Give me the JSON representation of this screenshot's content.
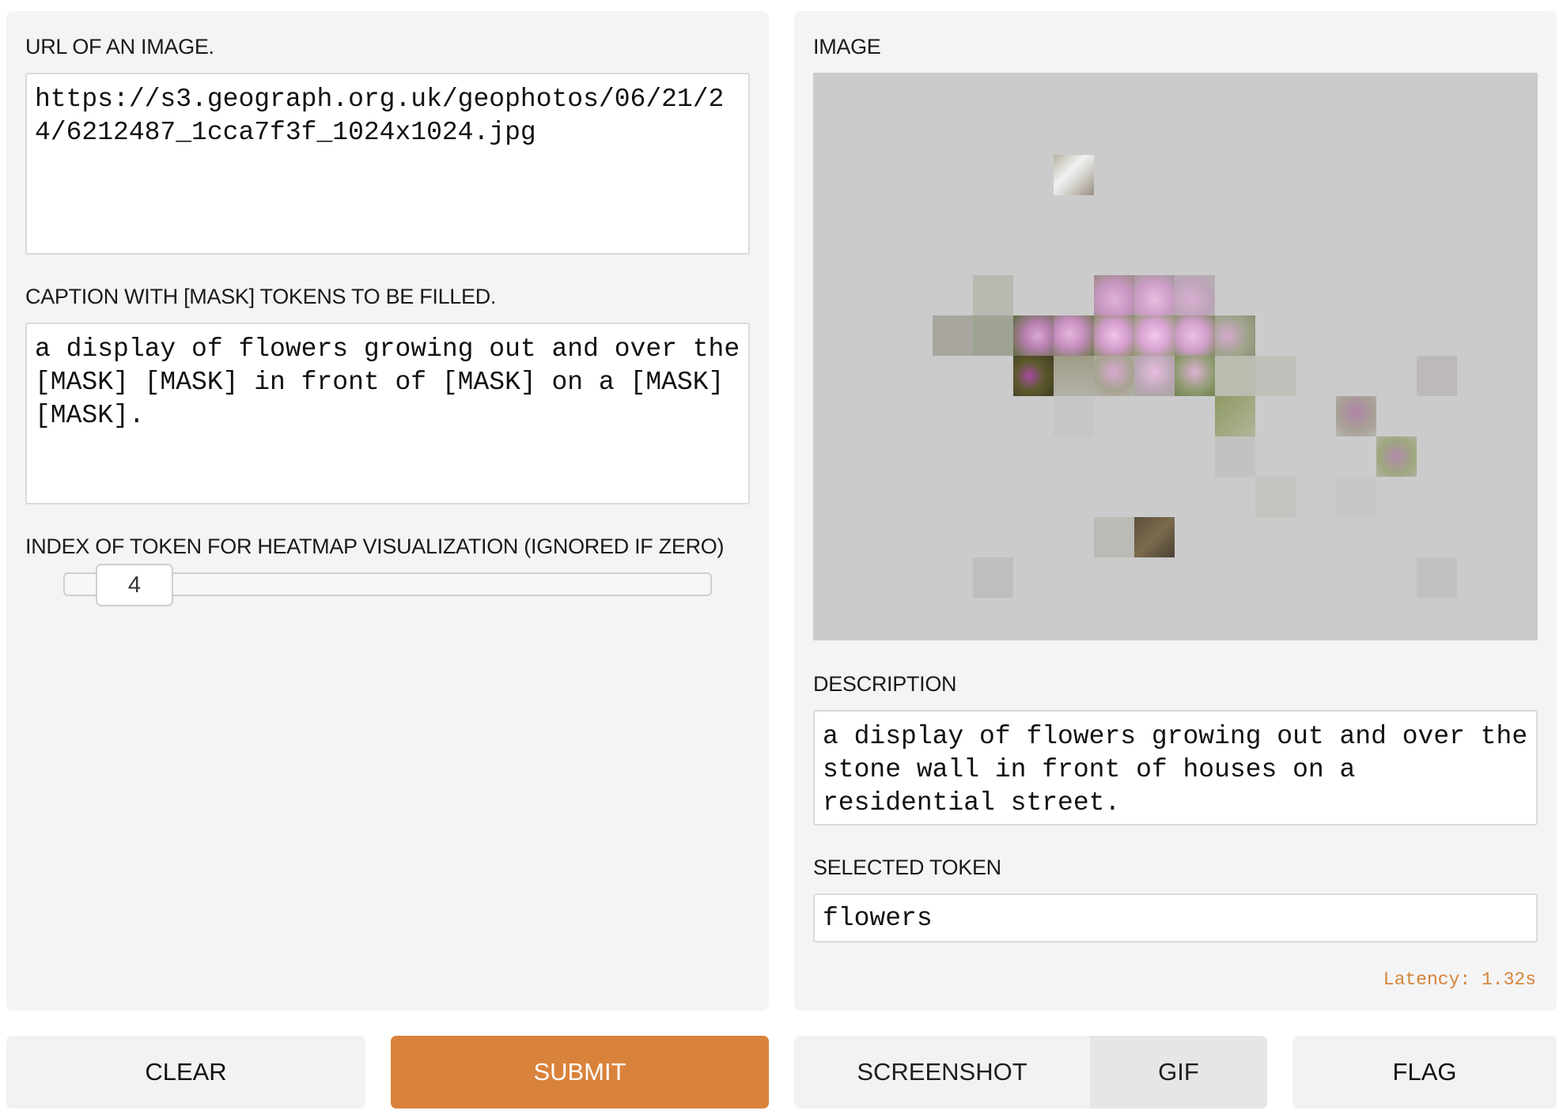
{
  "inputs": {
    "url_label": "URL OF AN IMAGE.",
    "url_value": "https://s3.geograph.org.uk/geophotos/06/21/24/6212487_1cca7f3f_1024x1024.jpg",
    "caption_label": "CAPTION WITH [MASK] TOKENS TO BE FILLED.",
    "caption_value": "a display of flowers growing out and over the [MASK] [MASK] in front of [MASK] on a [MASK] [MASK].",
    "token_index_label": "INDEX OF TOKEN FOR HEATMAP VISUALIZATION (IGNORED IF ZERO)",
    "token_index_value": "4"
  },
  "outputs": {
    "image_label": "IMAGE",
    "description_label": "DESCRIPTION",
    "description_value": "a display of flowers growing out and over the stone wall in front of houses on a residential street.",
    "selected_token_label": "SELECTED TOKEN",
    "selected_token_value": "flowers",
    "latency": "Latency: 1.32s"
  },
  "buttons": {
    "clear": "CLEAR",
    "submit": "SUBMIT",
    "screenshot": "SCREENSHOT",
    "gif": "GIF",
    "flag": "FLAG"
  },
  "colors": {
    "accent": "#d9823b",
    "panel_bg": "#f4f4f4",
    "mask_bg": "#cbcbcb"
  }
}
